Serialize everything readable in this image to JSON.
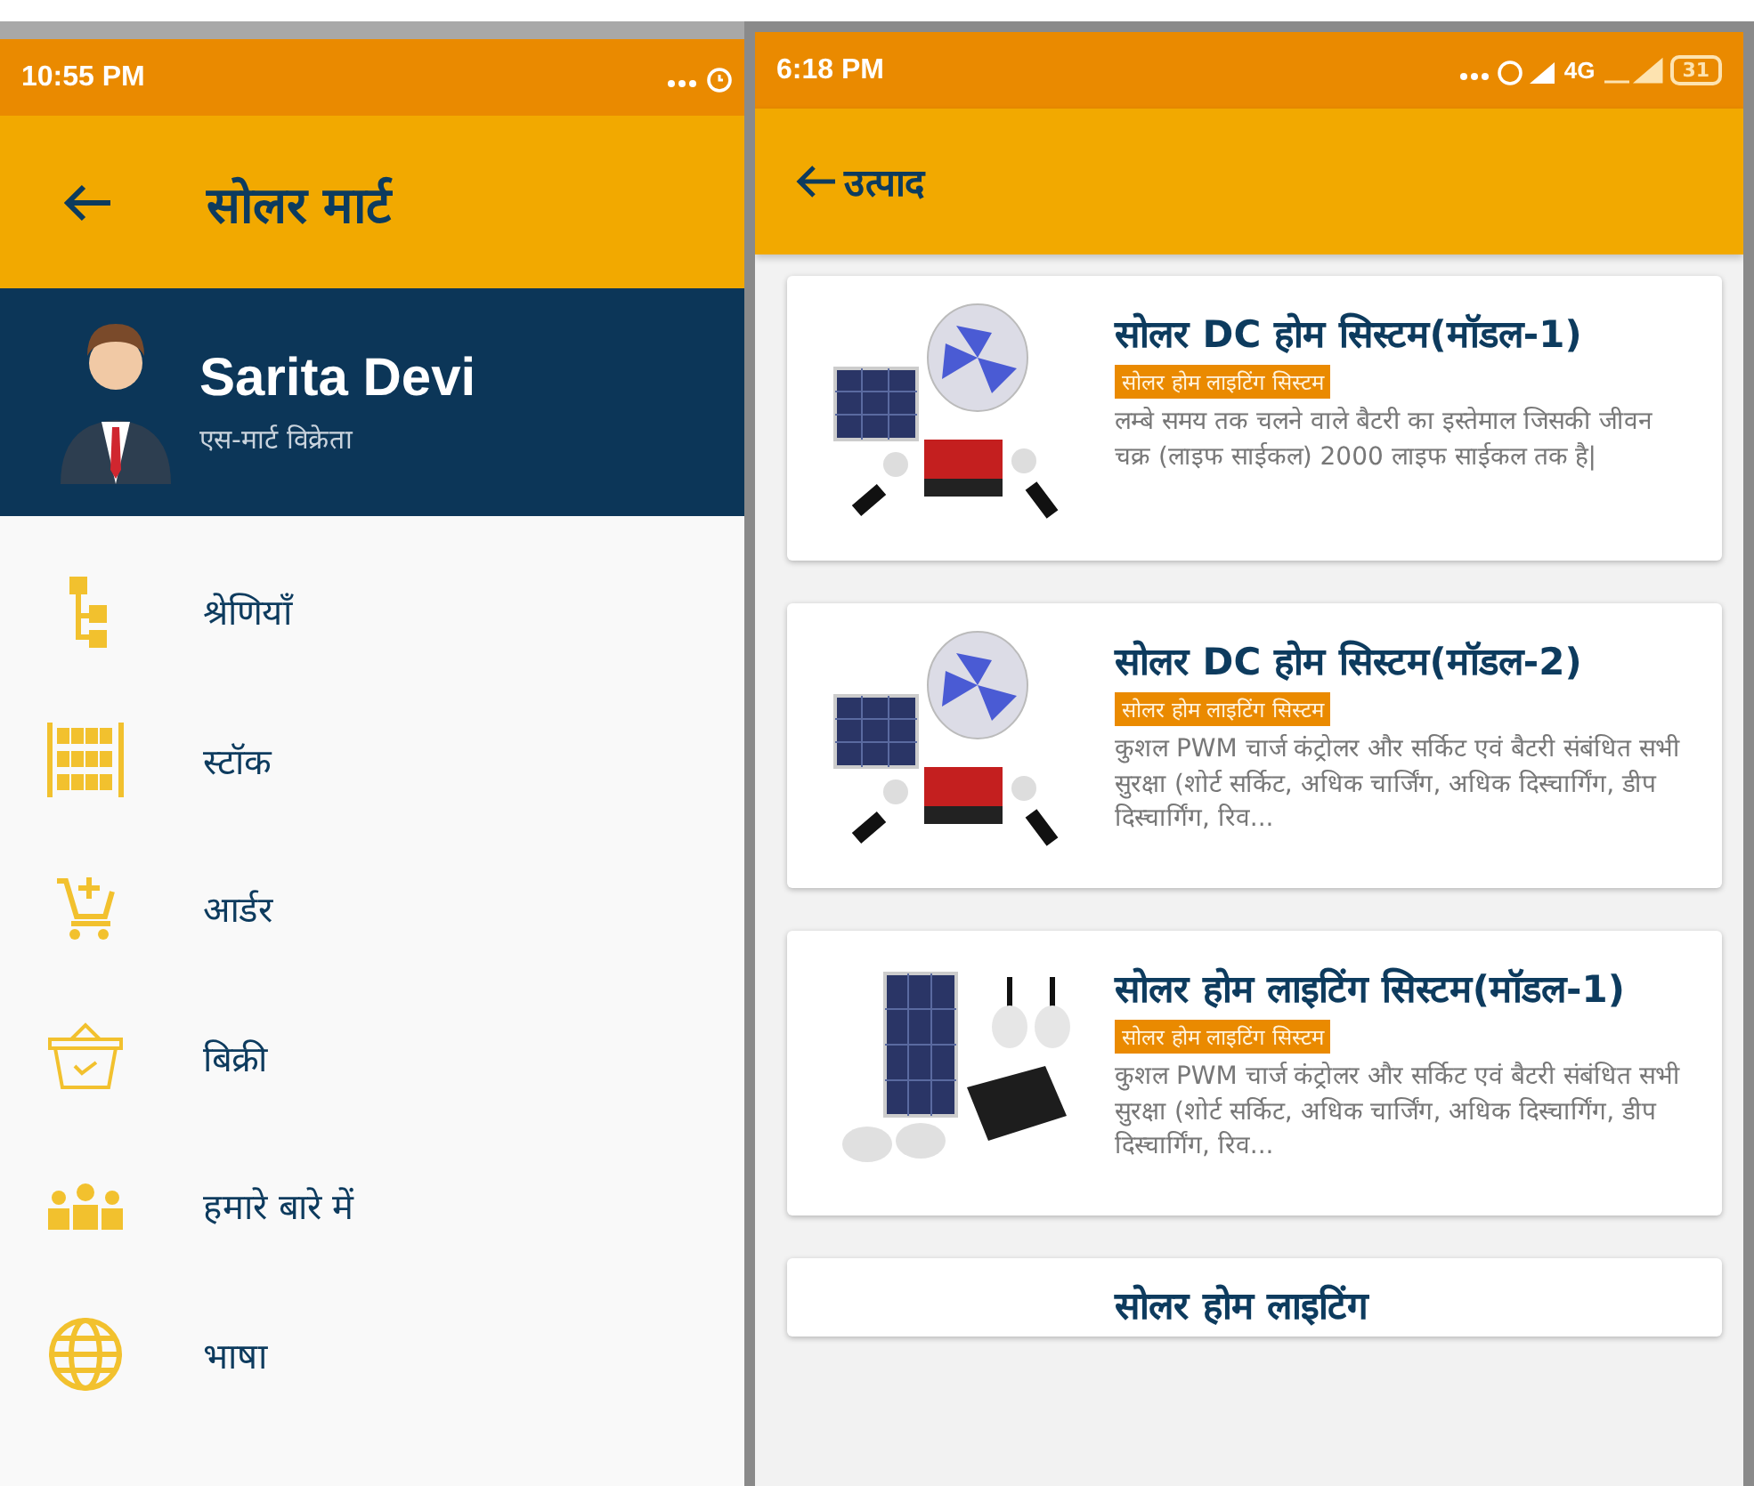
{
  "left_screen": {
    "status_bar": {
      "time": "10:55 PM"
    },
    "app_bar": {
      "title": "सोलर मार्ट"
    },
    "profile": {
      "name": "Sarita  Devi",
      "role": "एस-मार्ट विक्रेता"
    },
    "menu": [
      {
        "kind": "tree",
        "label": "श्रेणियाँ"
      },
      {
        "kind": "shelf",
        "label": "स्टॉक"
      },
      {
        "kind": "cart",
        "label": "आर्डर"
      },
      {
        "kind": "basket",
        "label": "बिक्री"
      },
      {
        "kind": "people",
        "label": "हमारे बारे में"
      },
      {
        "kind": "globe",
        "label": "भाषा"
      }
    ]
  },
  "right_screen": {
    "status_bar": {
      "time": "6:18 PM",
      "network": "4G",
      "battery": "31"
    },
    "app_bar": {
      "title": "उत्पाद"
    },
    "products": [
      {
        "kind": "fan_kit",
        "title": "सोलर DC होम सिस्टम(मॉडल-1)",
        "category": "सोलर होम लाइटिंग सिस्टम",
        "description": "लम्बे समय तक चलने वाले बैटरी का इस्तेमाल जिसकी जीवन चक्र (लाइफ साईकल) 2000 लाइफ साईकल तक है|"
      },
      {
        "kind": "fan_kit",
        "title": "सोलर DC होम सिस्टम(मॉडल-2)",
        "category": "सोलर होम लाइटिंग सिस्टम",
        "description": "कुशल PWM चार्ज कंट्रोलर और सर्किट एवं बैटरी संबंधित सभी सुरक्षा (शोर्ट सर्किट, अधिक चार्जिंग, अधिक दिस्चार्गिंग, डीप दिस्चार्गिंग, रिव..."
      },
      {
        "kind": "light_kit",
        "title": "सोलर होम लाइटिंग सिस्टम(मॉडल-1)",
        "category": "सोलर होम लाइटिंग सिस्टम",
        "description": "कुशल PWM चार्ज कंट्रोलर और सर्किट एवं बैटरी संबंधित सभी सुरक्षा (शोर्ट सर्किट, अधिक चार्जिंग, अधिक दिस्चार्गिंग, डीप दिस्चार्गिंग, रिव..."
      },
      {
        "kind": "partial",
        "title": "सोलर होम लाइटिंग"
      }
    ]
  }
}
